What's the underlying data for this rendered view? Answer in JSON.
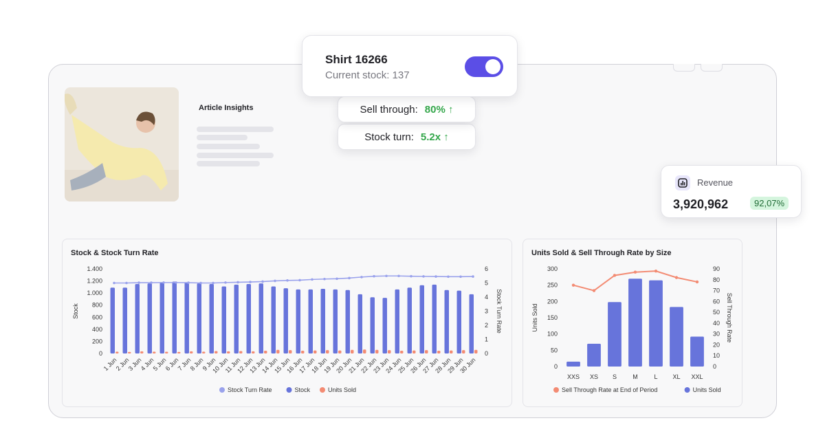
{
  "product": {
    "title": "Shirt 16266",
    "stock_label": "Current stock: 137",
    "tracking_on": true
  },
  "metrics": {
    "sell_through": {
      "label": "Sell through:",
      "value": "80% ↑"
    },
    "stock_turn": {
      "label": "Stock turn:",
      "value": "5.2x ↑"
    }
  },
  "article": {
    "title": "Article Insights"
  },
  "revenue": {
    "icon": "chart-icon",
    "label": "Revenue",
    "value": "3,920,962",
    "change": "92,07%"
  },
  "colors": {
    "accent": "#5b4ee6",
    "stock": "#6774db",
    "turn_rate": "#9aa2ec",
    "units_sold": "#f38b73",
    "positive": "#33a64a"
  },
  "chart_data": [
    {
      "type": "bar",
      "title": "Stock & Stock Turn Rate",
      "ylabel": "Stock",
      "y2label": "Stock Turn Rate",
      "ylim": [
        0,
        1400
      ],
      "y2lim": [
        0,
        6
      ],
      "yticks": [
        "0",
        "200",
        "400",
        "600",
        "800",
        "1.000",
        "1.200",
        "1.400"
      ],
      "y2ticks": [
        "0",
        "1",
        "2",
        "3",
        "4",
        "5",
        "6"
      ],
      "categories": [
        "1 Jun",
        "2 Jun",
        "3 Jun",
        "4 Jun",
        "5 Jun",
        "6 Jun",
        "7 Jun",
        "8 Jun",
        "9 Jun",
        "10 Jun",
        "11 Jun",
        "12 Jun",
        "13 Jun",
        "14 Jun",
        "15 Jun",
        "16 Jun",
        "17 Jun",
        "18 Jun",
        "19 Jun",
        "20 Jun",
        "21 Jun",
        "22 Jun",
        "23 Jun",
        "24 Jun",
        "25 Jun",
        "26 Jun",
        "27 Jun",
        "28 Jun",
        "29 Jun",
        "30 Jun"
      ],
      "series": [
        {
          "name": "Stock Turn Rate",
          "kind": "line",
          "axis": "right",
          "values": [
            5.0,
            5.0,
            5.02,
            5.02,
            5.03,
            5.03,
            5.02,
            5.0,
            5.0,
            5.03,
            5.05,
            5.07,
            5.1,
            5.15,
            5.18,
            5.2,
            5.25,
            5.28,
            5.3,
            5.35,
            5.42,
            5.48,
            5.5,
            5.5,
            5.48,
            5.47,
            5.46,
            5.45,
            5.45,
            5.46
          ]
        },
        {
          "name": "Stock",
          "kind": "bar",
          "axis": "left",
          "values": [
            1090,
            1090,
            1150,
            1160,
            1180,
            1190,
            1180,
            1160,
            1150,
            1110,
            1140,
            1150,
            1160,
            1110,
            1080,
            1060,
            1060,
            1070,
            1060,
            1050,
            980,
            930,
            920,
            1060,
            1090,
            1130,
            1140,
            1050,
            1040,
            980
          ]
        },
        {
          "name": "Units Sold",
          "kind": "bar",
          "axis": "left",
          "values": [
            30,
            25,
            35,
            30,
            28,
            25,
            35,
            30,
            40,
            35,
            40,
            35,
            45,
            60,
            55,
            45,
            50,
            55,
            50,
            60,
            65,
            60,
            55,
            45,
            50,
            55,
            45,
            50,
            55,
            60
          ]
        }
      ],
      "legend": "bottom"
    },
    {
      "type": "bar",
      "title": "Units Sold & Sell Through Rate by Size",
      "ylabel": "Units Sold",
      "y2label": "Sell Through Rate",
      "ylim": [
        0,
        300
      ],
      "y2lim": [
        0,
        90
      ],
      "yticks": [
        "0",
        "50",
        "100",
        "150",
        "200",
        "250",
        "300"
      ],
      "y2ticks": [
        "0",
        "10",
        "20",
        "30",
        "40",
        "50",
        "60",
        "70",
        "80",
        "90"
      ],
      "categories": [
        "XXS",
        "XS",
        "S",
        "M",
        "L",
        "XL",
        "XXL"
      ],
      "series": [
        {
          "name": "Sell Through Rate at End of Period",
          "kind": "line",
          "axis": "right",
          "values": [
            75,
            70,
            84,
            87,
            88,
            82,
            78
          ]
        },
        {
          "name": "Units Sold",
          "kind": "bar",
          "axis": "left",
          "values": [
            15,
            70,
            198,
            270,
            265,
            183,
            92
          ]
        }
      ],
      "legend": "bottom"
    }
  ]
}
